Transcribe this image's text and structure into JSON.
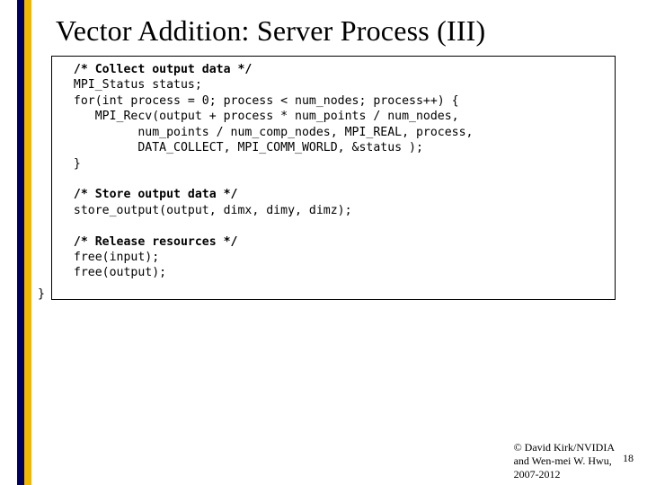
{
  "title": "Vector Addition: Server Process (III)",
  "code": {
    "c1": "  /* Collect output data */",
    "l2": "  MPI_Status status;",
    "l3": "  for(int process = 0; process < num_nodes; process++) {",
    "l4": "     MPI_Recv(output + process * num_points / num_nodes,",
    "l5": "           num_points / num_comp_nodes, MPI_REAL, process,",
    "l6": "           DATA_COLLECT, MPI_COMM_WORLD, &status );",
    "l7": "  }",
    "blank1": "",
    "c2": "  /* Store output data */",
    "l9": "  store_output(output, dimx, dimy, dimz);",
    "blank2": "",
    "c3": "  /* Release resources */",
    "l11": "  free(input);",
    "l12": "  free(output);"
  },
  "close_brace": "}",
  "footer": {
    "line1": "© David Kirk/NVIDIA",
    "line2": "and Wen-mei W. Hwu,",
    "line3": "2007-2012"
  },
  "page_number": "18"
}
